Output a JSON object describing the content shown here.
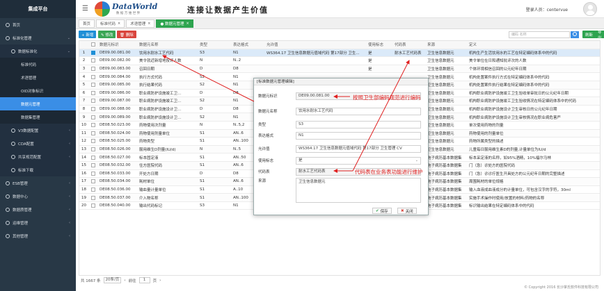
{
  "sidebar": {
    "brand": "集成平台",
    "items": [
      {
        "label": "首页",
        "level": 0
      },
      {
        "label": "标准化管理",
        "level": 0,
        "arrow": "⌄"
      },
      {
        "label": "数据标准化",
        "level": 1,
        "arrow": "⌄"
      },
      {
        "label": "标准代码",
        "level": 2
      },
      {
        "label": "术语管理",
        "level": 2
      },
      {
        "label": "OID对象标识",
        "level": 2
      },
      {
        "label": "数据元管理",
        "level": 2,
        "active": true
      },
      {
        "label": "数据集管理",
        "level": 2
      },
      {
        "label": "V3数据配置",
        "level": 1,
        "arrow": "‹"
      },
      {
        "label": "CDA配置",
        "level": 1,
        "arrow": "‹"
      },
      {
        "label": "共享规范配置",
        "level": 1,
        "arrow": "‹"
      },
      {
        "label": "标准下载",
        "level": 1
      },
      {
        "label": "ESB管理",
        "level": 0,
        "arrow": "‹"
      },
      {
        "label": "数据中心",
        "level": 0,
        "arrow": "‹"
      },
      {
        "label": "数据质管理",
        "level": 0,
        "arrow": "‹"
      },
      {
        "label": "运维管理",
        "level": 0,
        "arrow": "‹"
      },
      {
        "label": "其他管理",
        "level": 0,
        "arrow": "‹"
      }
    ]
  },
  "header": {
    "logo_text": "DataWorld",
    "logo_sub": "数 据 万 维 世 界",
    "slogan": "连接让数据产生价值",
    "user_label": "登录人员：centervue"
  },
  "tabs": [
    {
      "label": "首页"
    },
    {
      "label": "标准代码",
      "close": "×"
    },
    {
      "label": "术语管理",
      "close": "×"
    },
    {
      "label": "● 数据元管理",
      "close": "×",
      "active": true
    }
  ],
  "toolbar": {
    "add": "+ 新增",
    "edit": "✎ 修改",
    "delete": "🗑 删除",
    "search_placeholder": "编码 名称",
    "refresh": "刷新",
    "export": "导出"
  },
  "table": {
    "headers": [
      "",
      "",
      "数据元标识",
      "数据元名称",
      "类型",
      "表达格式",
      "允许值",
      "使用标志",
      "代码表",
      "来源",
      "定义"
    ],
    "rows": [
      [
        "1",
        "DE09.00.081.00",
        "饮用水耐水工艺代码",
        "S3",
        "N1",
        "WS364.17 卫生信息数据元值域代码 第17部分 卫生...",
        "是",
        "耐水工艺代码表",
        "卫生信息数据元",
        "机构生产生活饮用水的工艺在特定编码体系中的代码"
      ],
      [
        "2",
        "DE09.00.082.00",
        "美令就近新增地按评人数",
        "N",
        "N..2",
        "",
        "是",
        "",
        "卫生信息数据元",
        "美令单位在日和通知批评次的人数"
      ],
      [
        "3",
        "DE09.00.083.00",
        "召回日期",
        "D",
        "D8",
        "",
        "是",
        "",
        "卫生信息数据元",
        "个体环境相信召回的公元纪年日期"
      ],
      [
        "4",
        "DE09.00.084.00",
        "执行方式代码",
        "S2",
        "N1",
        "",
        "",
        "",
        "卫生信息数据元",
        "机构处置案件执行方式在特定编码体系中的代码"
      ],
      [
        "5",
        "DE09.00.085.00",
        "执行结果代码",
        "S2",
        "N1",
        "",
        "",
        "",
        "卫生信息数据元",
        "机构处置案件执行结果在特定编码体系中的代码"
      ],
      [
        "6",
        "DE09.00.086.00",
        "职业病防护设施竣工卫...",
        "D",
        "D8",
        "",
        "",
        "",
        "卫生信息数据元",
        "机构职业病防护设施竣工卫生验收单审批日的公元纪年日期"
      ],
      [
        "7",
        "DE09.00.087.00",
        "职业病防护设施竣工卫...",
        "S2",
        "N1",
        "",
        "",
        "",
        "卫生信息数据元",
        "机构职业病防护设施竣工卫生验收情况在特定编码体系中的代码"
      ],
      [
        "8",
        "DE09.00.088.00",
        "职业病防护设施设计卫...",
        "D",
        "D8",
        "",
        "",
        "",
        "卫生信息数据元",
        "机构职业病防护设施设计卫生审核日的公元纪年日期"
      ],
      [
        "9",
        "DE09.00.089.00",
        "职业病防护设施设计卫...",
        "S2",
        "N1",
        "",
        "",
        "",
        "卫生信息数据元",
        "机构职业病防护设施设计卫生审核情况在职业病危害严"
      ],
      [
        "10",
        "DE08.50.023.00",
        "药物使用次剂量",
        "N",
        "N..5,2",
        "",
        "",
        "",
        "卫生信息数据元",
        "单次使用药物的剂量"
      ],
      [
        "11",
        "DE08.50.024.00",
        "药物使用剂量单位",
        "S1",
        "AN..6",
        "",
        "",
        "",
        "卫生信息数据元",
        "药物使用的剂量单位"
      ],
      [
        "12",
        "DE08.50.025.00",
        "药物类型",
        "S1",
        "AN..100",
        "",
        "",
        "",
        "卫生信息数据元",
        "药物所属类型的描述"
      ],
      [
        "13",
        "DE08.50.026.00",
        "服用维生D剂量(IU/d)",
        "N",
        "N..5",
        "",
        "",
        "",
        "卫生信息数据元",
        "儿童每日服用维生素D的剂量,计量单位为IU/d"
      ],
      [
        "14",
        "DE08.50.027.00",
        "标本固定液",
        "S1",
        "AN..50",
        "",
        "",
        "",
        "电子病历基本数据集",
        "标本采定液的名称，如95%酒精，10%福尔马林"
      ],
      [
        "15",
        "DE08.50.032.00",
        "住方医院代码",
        "S1",
        "AN..6",
        "",
        "",
        "",
        "电子病历基本数据集",
        "门（急）诊处方的医院代码"
      ],
      [
        "16",
        "DE08.50.033.00",
        "开处方日期",
        "D",
        "D8",
        "",
        "",
        "",
        "电子病历基本数据集",
        "门（急）诊诊疗医生开具处方的公元纪年日期的完整描述"
      ],
      [
        "17",
        "DE08.50.034.00",
        "耗材单位",
        "S1",
        "AN..6",
        "—",
        "",
        "",
        "电子病历基本数据集",
        "周围耗材的单位规格"
      ],
      [
        "18",
        "DE08.50.036.00",
        "输血量计量单位",
        "S1",
        "A..10",
        "—",
        "",
        "",
        "电子病历基本数据集",
        "输入血液成血液成分的计量单位，可包含汉字的字符，30ml"
      ],
      [
        "19",
        "DE08.50.037.00",
        "介入物名称",
        "S1",
        "AN..100",
        "—",
        "",
        "",
        "电子病历基本数据集",
        "实施手术操作时使用/放置的材料/药物的名称"
      ],
      [
        "20",
        "DE08.50.040.00",
        "输出代码标记",
        "S3",
        "N1",
        "—",
        "",
        "输出代码标记表",
        "电子病历基本数据集",
        "标识输出结果在特定编码体系中的代码"
      ]
    ]
  },
  "pager": {
    "total": "共 1667 条",
    "per_page": "20条/页",
    "prev": "‹",
    "goto_label": "前往",
    "page": "1",
    "page_suffix": "页",
    "next": "›"
  },
  "footer": "© Copyright 2016 长沙掌氏软件科技有限公司",
  "dialog": {
    "title": "[标准数据元管理编辑]",
    "fields": [
      {
        "label": "数据元标识",
        "value": "DE09.00.081.00",
        "readonly": true
      },
      {
        "label": "数据元名称",
        "value": "饮用水耐水工艺代码"
      },
      {
        "label": "类型",
        "value": "S3"
      },
      {
        "label": "表达格式",
        "value": "N1"
      },
      {
        "label": "允许值",
        "value": "WS364.17 卫生信息数据元值域代码 第17部分 卫生管理 CV"
      },
      {
        "label": "使用标志",
        "value": "是",
        "dropdown": "⌄"
      },
      {
        "label": "代码表",
        "value": "耐水工艺代码表",
        "readonly": true
      },
      {
        "label": "来源",
        "value": "卫生信息数据元",
        "tall": true
      }
    ],
    "save": "保存",
    "close": "关闭"
  },
  "annotations": {
    "a1": "按照卫生部编码规范进行编码",
    "a2": "代码表在业务表功能进行维护"
  },
  "colors": {
    "sidebar_bg": "#283846",
    "active_blue": "#3a8ee6",
    "green": "#2ea44f",
    "annotation_red": "#e02020"
  }
}
